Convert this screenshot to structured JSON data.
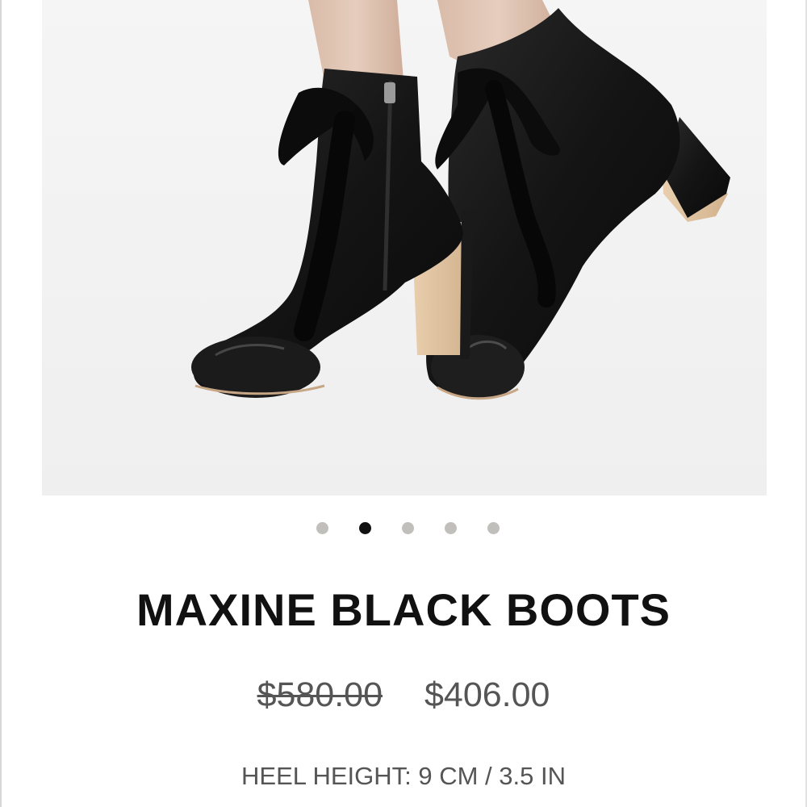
{
  "product": {
    "image_alt": "Black leather ankle boots with velvet ribbon laces",
    "title": "MAXINE BLACK BOOTS",
    "price_original": "$580.00",
    "price_sale": "$406.00",
    "spec": "HEEL HEIGHT: 9 CM / 3.5 IN"
  },
  "carousel": {
    "total_slides": 5,
    "active_index": 1
  },
  "colors": {
    "dot_inactive": "#c1bfbb",
    "dot_active": "#111111",
    "title_text": "#111111",
    "price_text": "#555555"
  }
}
